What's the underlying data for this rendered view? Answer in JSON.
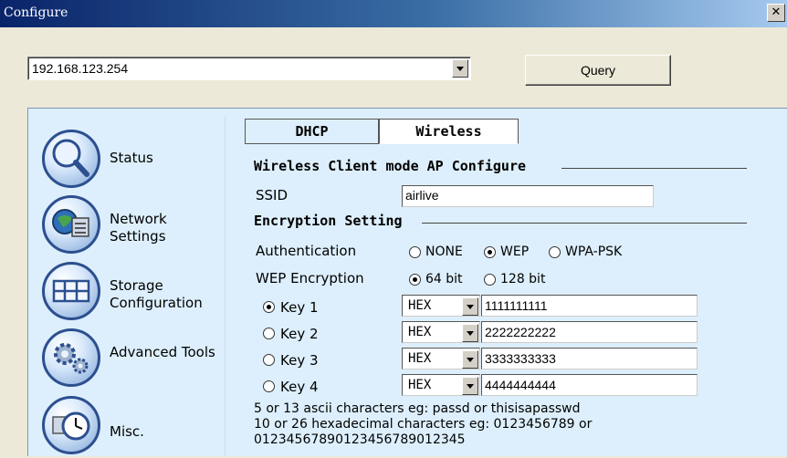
{
  "window": {
    "title": "Configure",
    "close_glyph": "✕"
  },
  "toolbar": {
    "ip_value": "192.168.123.254",
    "query_label": "Query"
  },
  "sidebar": {
    "items": [
      {
        "label": "Status",
        "icon": "magnifier-icon"
      },
      {
        "label": "Network Settings",
        "icon": "network-icon"
      },
      {
        "label": "Storage Configuration",
        "icon": "storage-icon"
      },
      {
        "label": "Advanced Tools",
        "icon": "gears-icon"
      },
      {
        "label": "Misc.",
        "icon": "clock-icon"
      }
    ]
  },
  "tabs": {
    "dhcp": "DHCP",
    "wireless": "Wireless"
  },
  "wireless": {
    "section_title": "Wireless Client mode AP Configure",
    "ssid_label": "SSID",
    "ssid_value": "airlive",
    "encryption_title": "Encryption Setting",
    "auth_label": "Authentication",
    "auth_options": [
      "NONE",
      "WEP",
      "WPA-PSK"
    ],
    "auth_selected": "WEP",
    "wep_label": "WEP Encryption",
    "wep_options": [
      "64 bit",
      "128 bit"
    ],
    "wep_selected": "64 bit",
    "keys": [
      {
        "label": "Key 1",
        "format": "HEX",
        "value": "1111111111",
        "selected": true
      },
      {
        "label": "Key 2",
        "format": "HEX",
        "value": "2222222222",
        "selected": false
      },
      {
        "label": "Key 3",
        "format": "HEX",
        "value": "3333333333",
        "selected": false
      },
      {
        "label": "Key 4",
        "format": "HEX",
        "value": "4444444444",
        "selected": false
      }
    ],
    "notes": [
      "5 or 13 ascii characters eg: passd or thisisapasswd",
      "10 or 26 hexadecimal characters eg: 0123456789 or",
      "01234567890123456789012345"
    ]
  }
}
